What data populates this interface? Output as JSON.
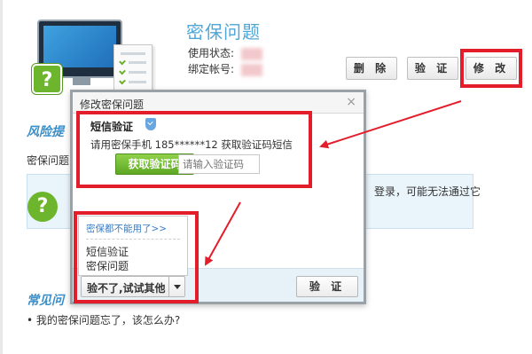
{
  "header": {
    "title": "密保问题",
    "status_label": "使用状态:",
    "account_label": "绑定帐号:"
  },
  "actions": {
    "delete_label": "删 除",
    "verify_label": "验 证",
    "modify_label": "修 改"
  },
  "background": {
    "risk_title": "风险提",
    "risk_text": "密保问题",
    "tip_text": "登录，可能无法通过它",
    "faq_title": "常见问",
    "faq_item": "我的密保问题忘了，该怎么办?"
  },
  "modal": {
    "title": "修改密保问题",
    "close_icon": "×",
    "sms_title": "短信验证",
    "sms_desc": "请用密保手机 185******12 获取验证码短信",
    "get_code_label": "获取验证码",
    "code_placeholder": "请输入验证码",
    "try_other_label": "验不了,试试其他",
    "verify_label": "验 证"
  },
  "dropdown": {
    "link": "密保都不能用了>>",
    "items": [
      "短信验证",
      "密保问题"
    ]
  },
  "colors": {
    "accent_blue": "#4fa7d8",
    "green_button": "#6db52c",
    "annotation_red": "#e41d2a"
  }
}
